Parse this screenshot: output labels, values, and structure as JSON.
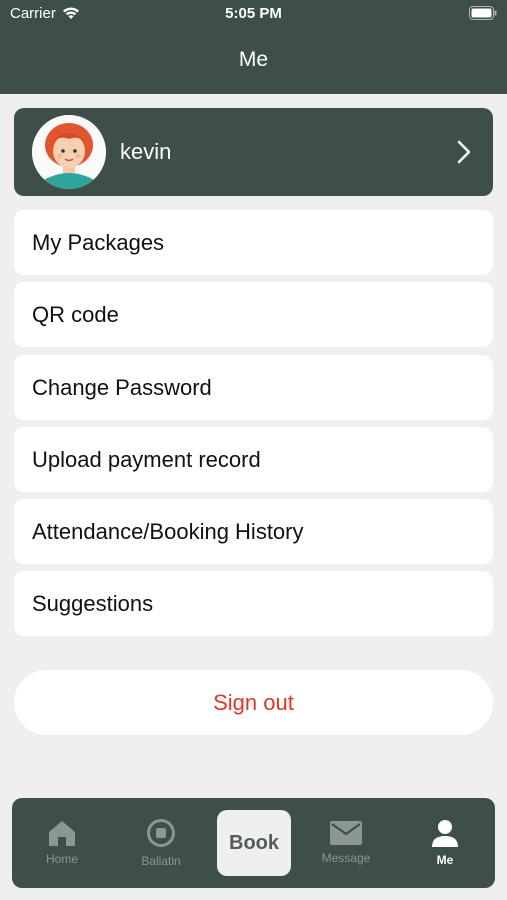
{
  "status": {
    "carrier": "Carrier",
    "time": "5:05 PM"
  },
  "header": {
    "title": "Me"
  },
  "profile": {
    "name": "kevin"
  },
  "menu": [
    {
      "label": "My Packages"
    },
    {
      "label": "QR code"
    },
    {
      "label": "Change Password"
    },
    {
      "label": "Upload payment record"
    },
    {
      "label": "Attendance/Booking History"
    },
    {
      "label": "Suggestions"
    }
  ],
  "signout": {
    "label": "Sign out"
  },
  "tabbar": {
    "home": "Home",
    "ballatin": "Ballatin",
    "book": "Book",
    "message": "Message",
    "me": "Me"
  },
  "colors": {
    "header": "#3e4e48",
    "signout": "#e0362a",
    "background": "#efefee"
  }
}
